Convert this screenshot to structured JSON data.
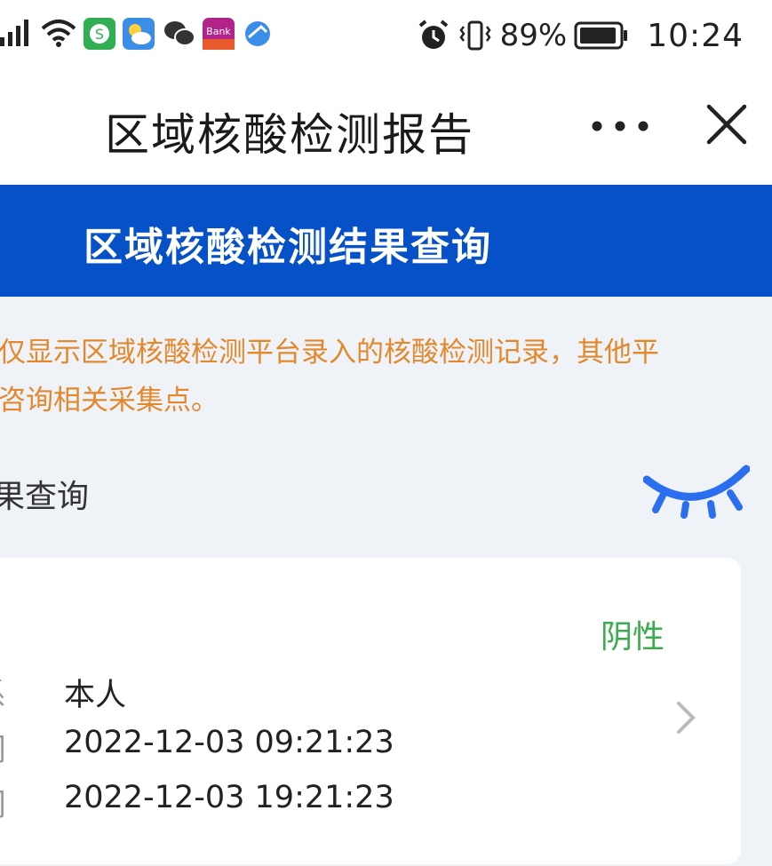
{
  "status_bar": {
    "battery": "89%",
    "time": "10:24",
    "icons": [
      "signal-icon",
      "wifi-icon",
      "app-icon-green",
      "weather-icon",
      "wechat-icon",
      "bank-app-icon",
      "browser-icon",
      "alarm-icon",
      "vibrate-icon",
      "battery-icon"
    ],
    "bank_label": "Bank"
  },
  "nav": {
    "title": "区域核酸检测报告",
    "more_label": "•••"
  },
  "header": {
    "title": "区域核酸检测结果查询",
    "color": "#0651c8"
  },
  "notice": {
    "line1": "仅显示区域核酸检测平台录入的核酸检测记录，其他平",
    "line2": "咨询相关采集点。",
    "color": "#e2892e"
  },
  "section": {
    "title": "果查询"
  },
  "record": {
    "result": "阴性",
    "result_color": "#3aae4f",
    "rows": [
      {
        "label": "系",
        "value": "本人"
      },
      {
        "label": "间",
        "value": "2022-12-03 09:21:23"
      },
      {
        "label": "间",
        "value": "2022-12-03 19:21:23"
      }
    ]
  }
}
